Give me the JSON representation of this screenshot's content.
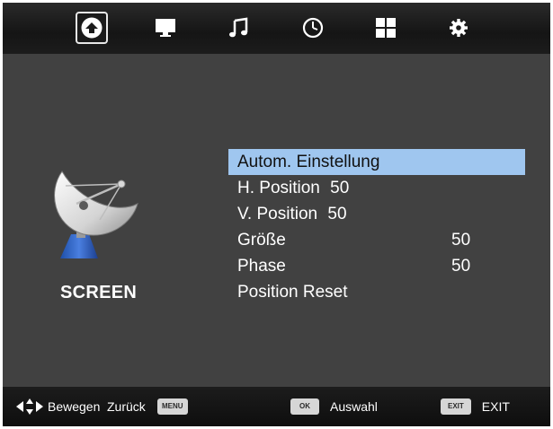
{
  "top_tabs": [
    {
      "name": "source",
      "icon": "satellite-tab-icon",
      "active": true
    },
    {
      "name": "screen",
      "icon": "monitor-icon",
      "active": false
    },
    {
      "name": "sound",
      "icon": "music-note-icon",
      "active": false
    },
    {
      "name": "time",
      "icon": "clock-icon",
      "active": false
    },
    {
      "name": "setup",
      "icon": "grid-icon",
      "active": false
    },
    {
      "name": "settings",
      "icon": "gear-icon",
      "active": false
    }
  ],
  "section": {
    "title": "SCREEN",
    "icon": "satellite-dish-icon"
  },
  "menu": {
    "selected_index": 0,
    "items": [
      {
        "label": "Autom. Einstellung",
        "value": ""
      },
      {
        "label": "H. Position",
        "value": "50"
      },
      {
        "label": "V. Position",
        "value": "50"
      },
      {
        "label": "Größe",
        "value": "50"
      },
      {
        "label": "Phase",
        "value": "50"
      },
      {
        "label": "Position Reset",
        "value": ""
      }
    ]
  },
  "footer": {
    "move_label": "Bewegen",
    "back_label": "Zurück",
    "menu_key": "MENU",
    "ok_key": "OK",
    "select_label": "Auswahl",
    "exit_key": "EXIT",
    "exit_label": "EXIT"
  },
  "colors": {
    "background": "#414141",
    "highlight": "#9fc6ef",
    "text": "#ffffff"
  }
}
